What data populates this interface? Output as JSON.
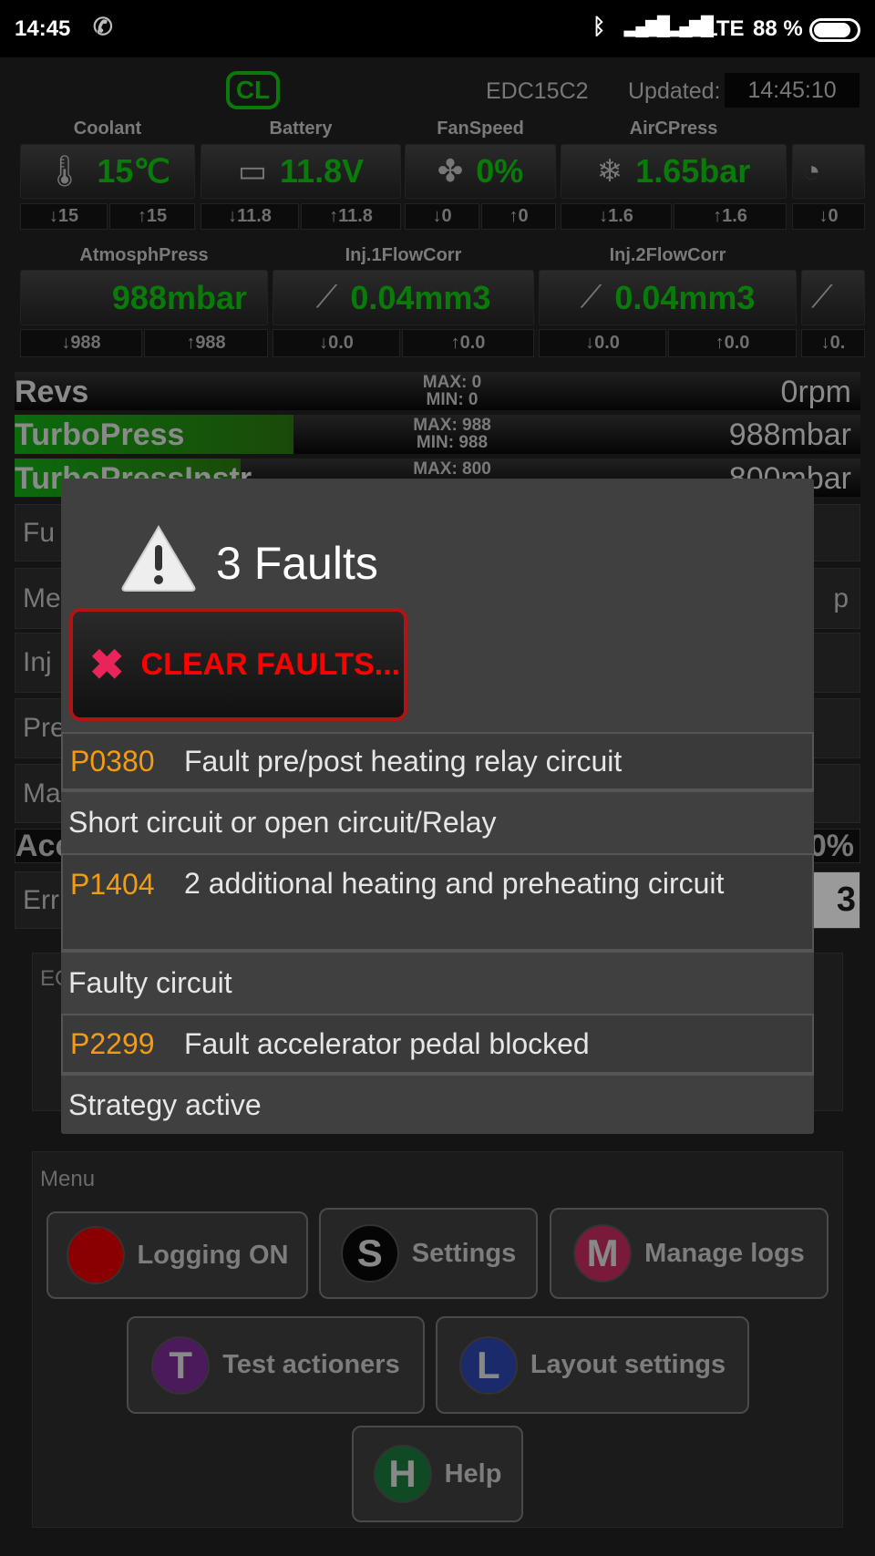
{
  "status_bar": {
    "time": "14:45",
    "network": "LTE",
    "battery": "88 %"
  },
  "header": {
    "mode_badge": "CL",
    "ecu": "EDC15C2",
    "updated_label": "Updated:",
    "updated_time": "14:45:10"
  },
  "gauges_row1": [
    {
      "label": "Coolant",
      "value": "15℃",
      "min": "↓15",
      "max": "↑15",
      "icon": "thermometer-icon"
    },
    {
      "label": "Battery",
      "value": "11.8V",
      "min": "↓11.8",
      "max": "↑11.8",
      "icon": "battery-icon"
    },
    {
      "label": "FanSpeed",
      "value": "0%",
      "min": "↓0",
      "max": "↑0",
      "icon": "fan-icon"
    },
    {
      "label": "AirCPress",
      "value": "1.65bar",
      "min": "↓1.6",
      "max": "↑1.6",
      "icon": "snowflake-icon"
    },
    {
      "label": "",
      "value": "",
      "min": "↓0",
      "max": "",
      "icon": "gauge-icon"
    }
  ],
  "gauges_row2": [
    {
      "label": "AtmosphPress",
      "value": "988mbar",
      "min": "↓988",
      "max": "↑988"
    },
    {
      "label": "Inj.1FlowCorr",
      "value": "0.04mm3",
      "min": "↓0.0",
      "max": "↑0.0",
      "icon": "injector-icon"
    },
    {
      "label": "Inj.2FlowCorr",
      "value": "0.04mm3",
      "min": "↓0.0",
      "max": "↑0.0",
      "icon": "injector-icon"
    },
    {
      "label": "",
      "value": "",
      "min": "↓0.",
      "max": "",
      "icon": "injector-icon"
    }
  ],
  "bars": [
    {
      "name": "Revs",
      "max": "MAX: 0",
      "min": "MIN: 0",
      "value": "0rpm",
      "fill": 0
    },
    {
      "name": "TurboPress",
      "max": "MAX: 988",
      "min": "MIN: 988",
      "value": "988mbar",
      "fill": 0.33
    },
    {
      "name": "TurboPressInstr",
      "max": "MAX: 800",
      "min": "",
      "value": "800mbar",
      "fill": 0.27
    }
  ],
  "background_rows": [
    "Fu",
    "Me",
    "Inj",
    "Pre",
    "Ma"
  ],
  "background_extra": {
    "acc": "Acc",
    "acc_value": "0%",
    "err": "Err",
    "err_value": "3",
    "ec": "EC",
    "ec_right": "p"
  },
  "dialog": {
    "title": "3 Faults",
    "clear_button": "CLEAR FAULTS...",
    "faults": [
      {
        "code": "P0380",
        "text": "Fault pre/post heating relay circuit",
        "detail": "Short circuit or open circuit/Relay"
      },
      {
        "code": "P1404",
        "text": "2 additional heating and preheating circuit",
        "detail": "Faulty circuit"
      },
      {
        "code": "P2299",
        "text": "Fault accelerator pedal blocked",
        "detail": "Strategy active"
      }
    ]
  },
  "menu": {
    "title": "Menu",
    "buttons": [
      {
        "letter": "",
        "label": "Logging  ON",
        "color": "#8a0000"
      },
      {
        "letter": "S",
        "label": "Settings",
        "color": "#050505"
      },
      {
        "letter": "M",
        "label": "Manage logs",
        "color": "#7a1a3a"
      },
      {
        "letter": "T",
        "label": "Test actioners",
        "color": "#4a1a5a"
      },
      {
        "letter": "L",
        "label": "Layout settings",
        "color": "#1a2a6a"
      },
      {
        "letter": "H",
        "label": "Help",
        "color": "#0f4a25"
      }
    ]
  }
}
